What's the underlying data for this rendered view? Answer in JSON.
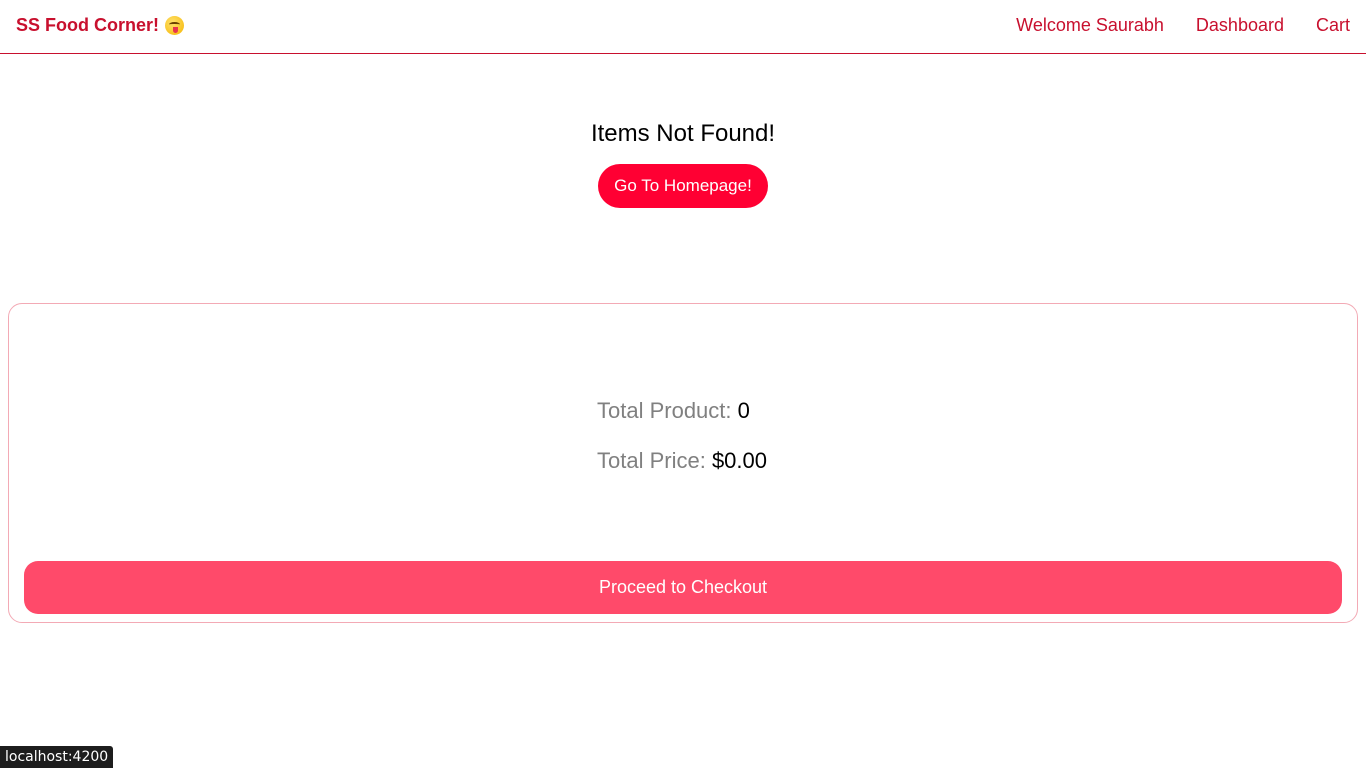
{
  "header": {
    "logo_text": "SS Food Corner!",
    "logo_emoji_icon": "face-savoring-food-emoji",
    "nav": {
      "welcome": "Welcome Saurabh",
      "dashboard": "Dashboard",
      "cart": "Cart"
    }
  },
  "empty_state": {
    "title": "Items Not Found!",
    "button_label": "Go To Homepage!"
  },
  "summary": {
    "total_product_label": "Total Product:",
    "total_product_value": "0",
    "total_price_label": "Total Price:",
    "total_price_value": "$0.00",
    "checkout_label": "Proceed to Checkout"
  },
  "status_bar": {
    "url": "localhost:4200"
  },
  "colors": {
    "brand": "#c8102e",
    "primary_button": "#ff0033",
    "checkout_button": "#ff4a6a",
    "card_border": "#f3aab5"
  }
}
